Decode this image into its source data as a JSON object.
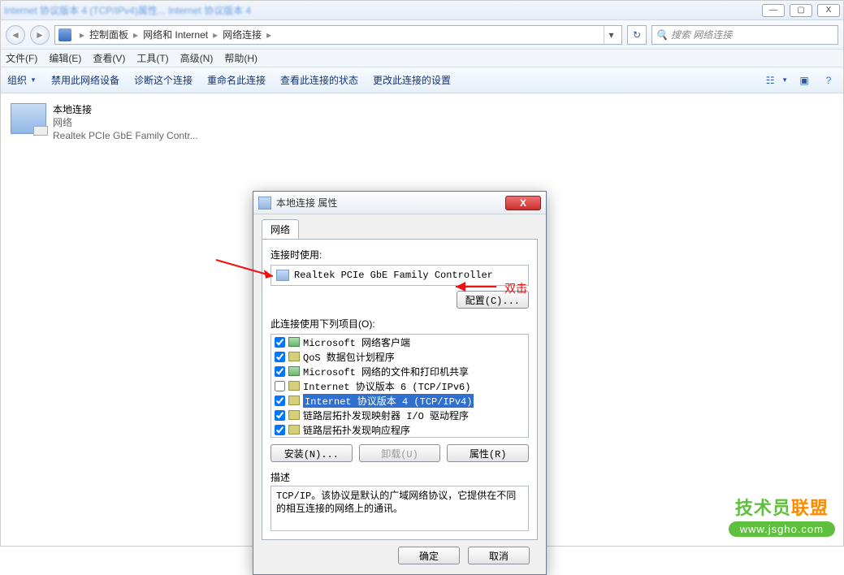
{
  "window_title_blur": "Internet 协议版本 4 (TCP/IPv4)属性... Internet 协议版本 4",
  "win_controls": {
    "min": "—",
    "max": "▢",
    "close": "X"
  },
  "breadcrumb": {
    "items": [
      "控制面板",
      "网络和 Internet",
      "网络连接"
    ]
  },
  "search": {
    "placeholder": "搜索 网络连接"
  },
  "menu": [
    "文件(F)",
    "编辑(E)",
    "查看(V)",
    "工具(T)",
    "高级(N)",
    "帮助(H)"
  ],
  "toolbar": {
    "organize": "组织",
    "items": [
      "禁用此网络设备",
      "诊断这个连接",
      "重命名此连接",
      "查看此连接的状态",
      "更改此连接的设置"
    ]
  },
  "connection": {
    "name": "本地连接",
    "status": "网络",
    "adapter": "Realtek PCIe GbE Family Contr..."
  },
  "dialog": {
    "title": "本地连接 属性",
    "tab": "网络",
    "connect_using_label": "连接时使用:",
    "adapter": "Realtek PCIe GbE Family Controller",
    "configure_btn": "配置(C)...",
    "items_label": "此连接使用下列项目(O):",
    "items": [
      {
        "checked": true,
        "text": "Microsoft 网络客户端",
        "icon": "net"
      },
      {
        "checked": true,
        "text": "QoS 数据包计划程序",
        "icon": "svc"
      },
      {
        "checked": true,
        "text": "Microsoft 网络的文件和打印机共享",
        "icon": "net"
      },
      {
        "checked": false,
        "text": "Internet 协议版本 6 (TCP/IPv6)",
        "icon": "proto"
      },
      {
        "checked": true,
        "text": "Internet 协议版本 4 (TCP/IPv4)",
        "icon": "proto",
        "selected": true
      },
      {
        "checked": true,
        "text": "链路层拓扑发现映射器 I/O 驱动程序",
        "icon": "proto"
      },
      {
        "checked": true,
        "text": "链路层拓扑发现响应程序",
        "icon": "proto"
      }
    ],
    "install_btn": "安装(N)...",
    "uninstall_btn": "卸载(U)",
    "props_btn": "属性(R)",
    "desc_label": "描述",
    "desc_text": "TCP/IP。该协议是默认的广域网络协议，它提供在不同的相互连接的网络上的通讯。",
    "ok": "确定",
    "cancel": "取消"
  },
  "annotation": {
    "text": "双击"
  },
  "watermark": {
    "brand_pre": "技术员",
    "brand_accent": "联盟",
    "url": "www.jsgho.com"
  }
}
